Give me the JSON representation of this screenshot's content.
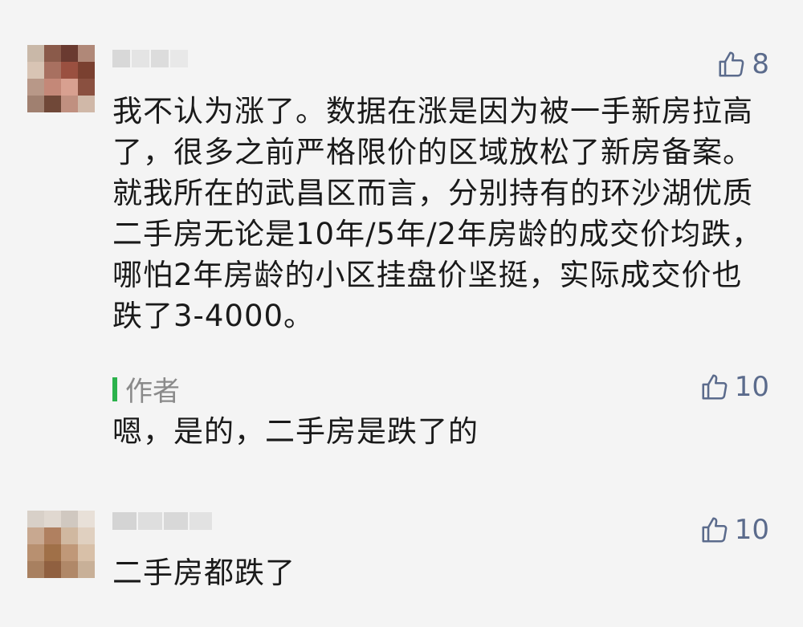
{
  "comments": [
    {
      "like_count": "8",
      "text": "我不认为涨了。数据在涨是因为被一手新房拉高了，很多之前严格限价的区域放松了新房备案。就我所在的武昌区而言，分别持有的环沙湖优质二手房无论是10年/5年/2年房龄的成交价均跌，哪怕2年房龄的小区挂盘价坚挺，实际成交价也跌了3-4000。",
      "reply": {
        "label": "作者",
        "like_count": "10",
        "text": "嗯，是的，二手房是跌了的"
      }
    },
    {
      "like_count": "10",
      "text": "二手房都跌了"
    }
  ],
  "colors": {
    "like": "#5b6b8c",
    "author_bar": "#2bb24c",
    "text": "#1a1a1a",
    "muted": "#8a8a8a"
  },
  "icons": {
    "like": "thumbs-up-outline-icon"
  }
}
